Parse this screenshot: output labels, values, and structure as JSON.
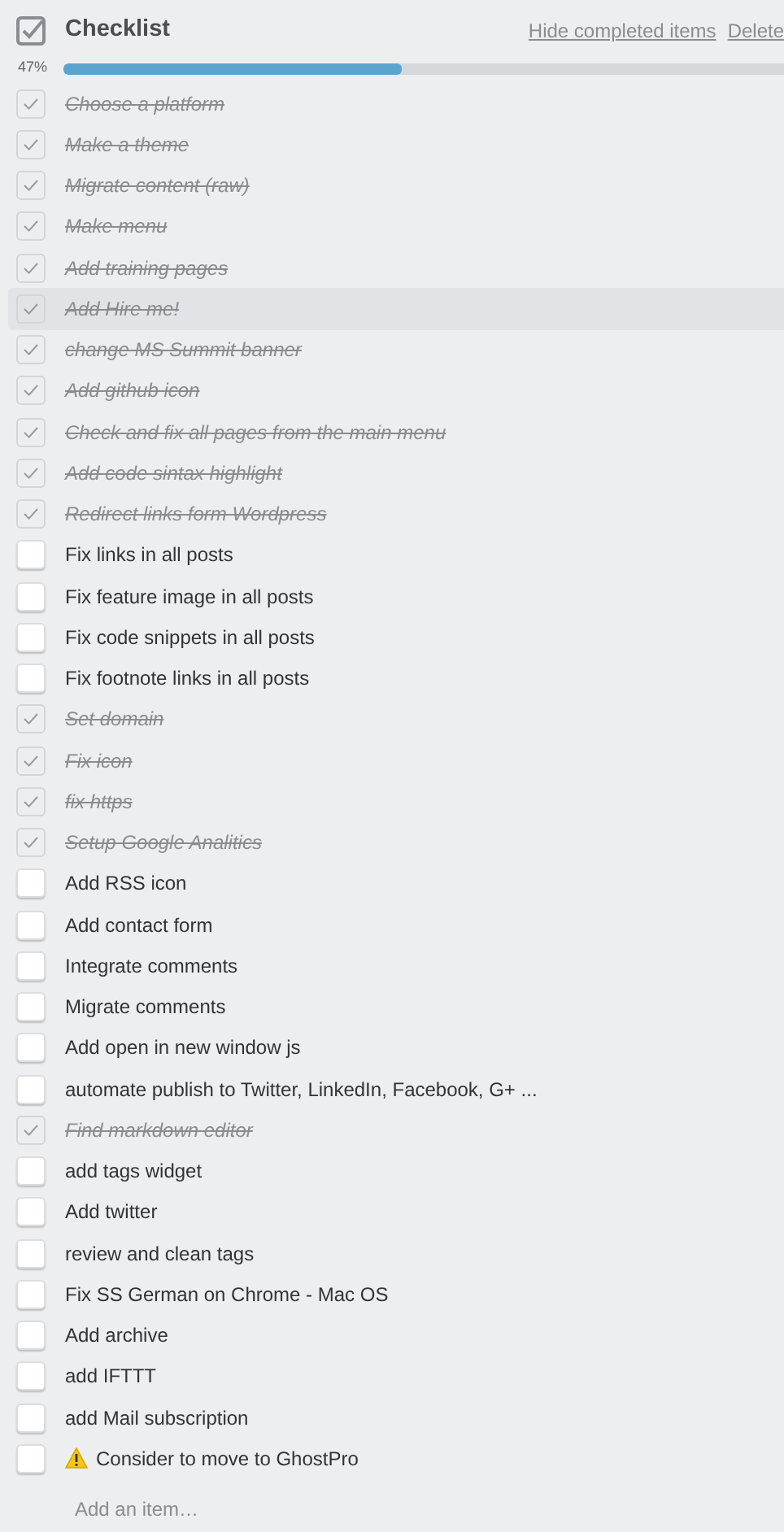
{
  "checklist": {
    "title": "Checklist",
    "actions": [
      "Hide completed items",
      "Delete"
    ],
    "progress": {
      "label": "47%",
      "level": 0.47
    },
    "items": [
      {
        "text": "Choose a platform",
        "checked": true,
        "highlighted": false
      },
      {
        "text": "Make a theme",
        "checked": true,
        "highlighted": false
      },
      {
        "text": "Migrate content (raw)",
        "checked": true,
        "highlighted": false
      },
      {
        "text": "Make menu",
        "checked": true,
        "highlighted": false
      },
      {
        "text": "Add training pages",
        "checked": true,
        "highlighted": false
      },
      {
        "text": "Add Hire me!",
        "checked": true,
        "highlighted": true
      },
      {
        "text": "change MS Summit banner",
        "checked": true,
        "highlighted": false
      },
      {
        "text": "Add github icon",
        "checked": true,
        "highlighted": false
      },
      {
        "text": "Check and fix all pages from the main menu",
        "checked": true,
        "highlighted": false
      },
      {
        "text": "Add code sintax highlight",
        "checked": true,
        "highlighted": false
      },
      {
        "text": "Redirect links form Wordpress",
        "checked": true,
        "highlighted": false
      },
      {
        "text": "Fix links in all posts",
        "checked": false,
        "highlighted": false
      },
      {
        "text": "Fix feature image in all posts",
        "checked": false,
        "highlighted": false
      },
      {
        "text": "Fix code snippets in all posts",
        "checked": false,
        "highlighted": false
      },
      {
        "text": "Fix footnote links in all posts",
        "checked": false,
        "highlighted": false
      },
      {
        "text": "Set domain",
        "checked": true,
        "highlighted": false
      },
      {
        "text": "Fix icon",
        "checked": true,
        "highlighted": false
      },
      {
        "text": "fix https",
        "checked": true,
        "highlighted": false
      },
      {
        "text": "Setup Google Analitics",
        "checked": true,
        "highlighted": false
      },
      {
        "text": "Add RSS icon",
        "checked": false,
        "highlighted": false
      },
      {
        "text": "Add contact form",
        "checked": false,
        "highlighted": false
      },
      {
        "text": "Integrate comments",
        "checked": false,
        "highlighted": false
      },
      {
        "text": "Migrate comments",
        "checked": false,
        "highlighted": false
      },
      {
        "text": "Add open in new window js",
        "checked": false,
        "highlighted": false
      },
      {
        "text": "automate publish to Twitter, LinkedIn, Facebook, G+ ...",
        "checked": false,
        "highlighted": false
      },
      {
        "text": "Find markdown editor",
        "checked": true,
        "highlighted": false
      },
      {
        "text": "add tags widget",
        "checked": false,
        "highlighted": false
      },
      {
        "text": "Add twitter",
        "checked": false,
        "highlighted": false
      },
      {
        "text": "review and clean tags",
        "checked": false,
        "highlighted": false
      },
      {
        "text": "Fix SS German on Chrome - Mac OS",
        "checked": false,
        "highlighted": false
      },
      {
        "text": "Add archive",
        "checked": false,
        "highlighted": false
      },
      {
        "text": "add IFTTT",
        "checked": false,
        "highlighted": false
      },
      {
        "text": "add Mail subscription",
        "checked": false,
        "highlighted": false
      },
      {
        "text": "Consider to move to GhostPro",
        "checked": false,
        "highlighted": false,
        "kind": "warning"
      }
    ],
    "add_item": {
      "placeholder": "Add an item…"
    }
  }
}
